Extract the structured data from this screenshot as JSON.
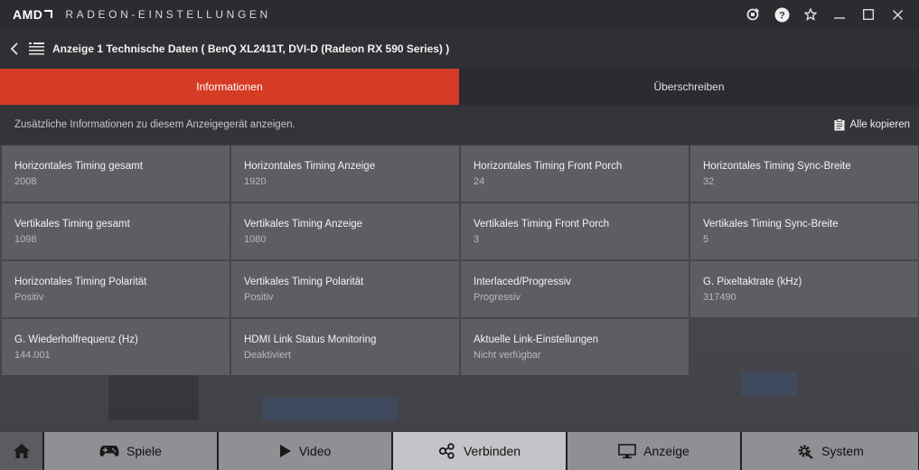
{
  "app": {
    "logo": "AMD",
    "title": "RADEON-EINSTELLUNGEN"
  },
  "window_controls": [
    "refresh-icon",
    "help-icon",
    "star-icon",
    "minimize-icon",
    "maximize-icon",
    "close-icon"
  ],
  "header": {
    "page_title": "Anzeige 1 Technische Daten ( BenQ XL2411T, DVI-D (Radeon RX 590 Series) )"
  },
  "tabs": [
    {
      "label": "Informationen",
      "active": true
    },
    {
      "label": "Überschreiben",
      "active": false
    }
  ],
  "info": {
    "description": "Zusätzliche Informationen zu diesem Anzeigegerät anzeigen.",
    "copy_all": "Alle kopieren"
  },
  "specs": [
    {
      "label": "Horizontales Timing gesamt",
      "value": "2008"
    },
    {
      "label": "Horizontales Timing Anzeige",
      "value": "1920"
    },
    {
      "label": "Horizontales Timing Front Porch",
      "value": "24"
    },
    {
      "label": "Horizontales Timing Sync-Breite",
      "value": "32"
    },
    {
      "label": "Vertikales Timing gesamt",
      "value": "1098"
    },
    {
      "label": "Vertikales Timing Anzeige",
      "value": "1080"
    },
    {
      "label": "Vertikales Timing Front Porch",
      "value": "3"
    },
    {
      "label": "Vertikales Timing Sync-Breite",
      "value": "5"
    },
    {
      "label": "Horizontales Timing Polarität",
      "value": "Positiv"
    },
    {
      "label": "Vertikales Timing Polarität",
      "value": "Positiv"
    },
    {
      "label": "Interlaced/Progressiv",
      "value": "Progressiv"
    },
    {
      "label": "G. Pixeltaktrate (kHz)",
      "value": "317490"
    },
    {
      "label": "G. Wiederholfrequenz (Hz)",
      "value": "144.001"
    },
    {
      "label": "HDMI Link Status Monitoring",
      "value": "Deaktiviert"
    },
    {
      "label": "Aktuelle Link-Einstellungen",
      "value": "Nicht verfügbar"
    }
  ],
  "bottom_nav": [
    {
      "label": "Spiele",
      "icon": "gamepad-icon",
      "selected": false
    },
    {
      "label": "Video",
      "icon": "play-icon",
      "selected": false
    },
    {
      "label": "Verbinden",
      "icon": "connect-icon",
      "selected": true
    },
    {
      "label": "Anzeige",
      "icon": "monitor-icon",
      "selected": false
    },
    {
      "label": "System",
      "icon": "gear-icon",
      "selected": false
    }
  ],
  "colors": {
    "accent": "#d63b25",
    "tab_inactive": "#2b2c2f",
    "cell_bg": "#5f6166",
    "nav_bg": "#8e9094",
    "nav_selected": "#c3c4c7"
  }
}
